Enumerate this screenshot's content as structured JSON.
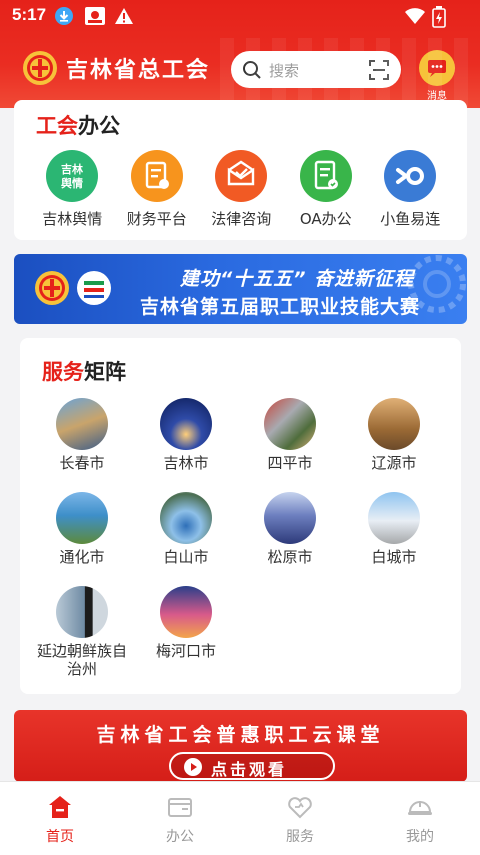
{
  "status_bar": {
    "time": "5:17"
  },
  "header": {
    "brand_title": "吉林省总工会",
    "search_placeholder": "搜索",
    "message_label": "消息"
  },
  "office_section": {
    "title_accent": "工会",
    "title_rest": "办公",
    "apps": [
      {
        "label": "吉林舆情",
        "icon_text": "吉林\n舆情",
        "color": "#2bb673",
        "icon": "public-opinion-icon"
      },
      {
        "label": "财务平台",
        "color": "#f7941d",
        "icon": "finance-icon"
      },
      {
        "label": "法律咨询",
        "color": "#f15a24",
        "icon": "legal-consult-icon"
      },
      {
        "label": "OA办公",
        "color": "#39b54a",
        "icon": "oa-icon"
      },
      {
        "label": "小鱼易连",
        "color": "#3a7bd5",
        "icon": "xiaoyu-icon"
      }
    ]
  },
  "banner_competition": {
    "line1": "建功“十五五” 奋进新征程",
    "line2": "吉林省第五届职工职业技能大赛"
  },
  "service_section": {
    "title_accent": "服务",
    "title_rest": "矩阵",
    "cities": [
      {
        "label": "长春市"
      },
      {
        "label": "吉林市"
      },
      {
        "label": "四平市"
      },
      {
        "label": "辽源市"
      },
      {
        "label": "通化市"
      },
      {
        "label": "白山市"
      },
      {
        "label": "松原市"
      },
      {
        "label": "白城市"
      },
      {
        "label": "延边朝鲜族自治州"
      },
      {
        "label": "梅河口市"
      }
    ]
  },
  "banner_classroom": {
    "title": "吉林省工会普惠职工云课堂",
    "button": "点击观看"
  },
  "tabbar": {
    "tabs": [
      {
        "label": "首页",
        "active": true
      },
      {
        "label": "办公",
        "active": false
      },
      {
        "label": "服务",
        "active": false
      },
      {
        "label": "我的",
        "active": false
      }
    ]
  },
  "colors": {
    "brand_red": "#e5221a",
    "accent_yellow": "#f7c23a",
    "banner_blue": "#2a6ae0"
  }
}
